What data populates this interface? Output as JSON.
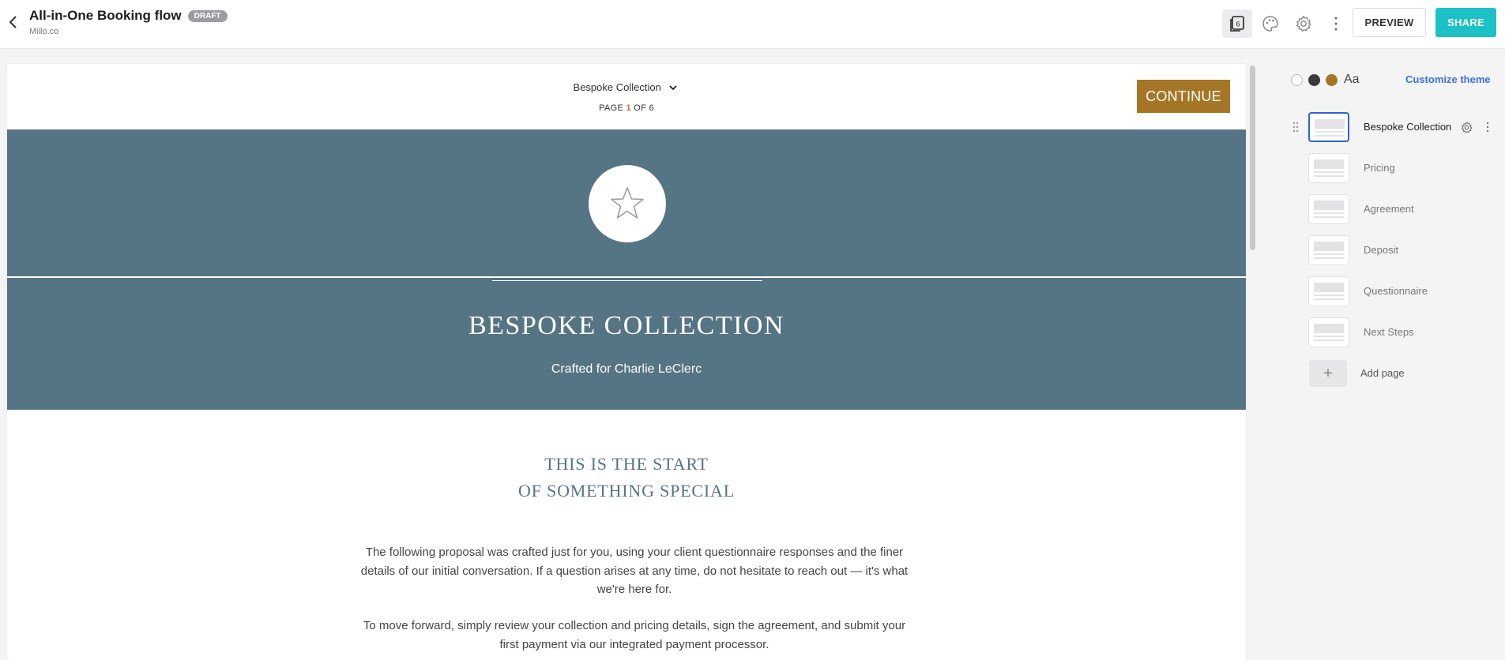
{
  "header": {
    "title": "All-in-One Booking flow",
    "badge": "DRAFT",
    "subtitle": "Millo.co",
    "pages_count_icon": "6",
    "preview_label": "PREVIEW",
    "share_label": "SHARE"
  },
  "icons": {
    "back": "chevron-left-icon",
    "pages": "pages-stack-icon",
    "theme": "palette-icon",
    "settings": "gear-icon",
    "more": "vertical-dots-icon",
    "star": "star-icon"
  },
  "canvas": {
    "page_selector": "Bespoke Collection",
    "page_count_prefix": "PAGE ",
    "page_count_current": "1",
    "page_count_suffix": " OF 6",
    "continue_label": "CONTINUE",
    "hero_title": "BESPOKE COLLECTION",
    "hero_subtitle": "Crafted for Charlie LeClerc",
    "intro_title_line1": "THIS IS THE START",
    "intro_title_line2": "OF SOMETHING SPECIAL",
    "paragraph1": "The following proposal was crafted just for you, using your client questionnaire responses and the finer details of our initial conversation. If a question arises at any time, do not hesitate to reach out — it's what we're here for.",
    "paragraph2": "To move forward, simply review your collection and pricing details, sign the agreement, and submit your first payment via our integrated payment processor."
  },
  "theme": {
    "swatch_colors": [
      "#ffffff",
      "#3a3a3c",
      "#a57625"
    ],
    "font_label": "Aa",
    "customize_label": "Customize theme",
    "hero_color": "#557484",
    "accent_color": "#a57625",
    "share_color": "#1bc1c7"
  },
  "sidebar": {
    "pages": [
      {
        "label": "Bespoke Collection",
        "selected": true
      },
      {
        "label": "Pricing",
        "selected": false
      },
      {
        "label": "Agreement",
        "selected": false
      },
      {
        "label": "Deposit",
        "selected": false
      },
      {
        "label": "Questionnaire",
        "selected": false
      },
      {
        "label": "Next Steps",
        "selected": false
      }
    ],
    "add_page_label": "Add page"
  }
}
